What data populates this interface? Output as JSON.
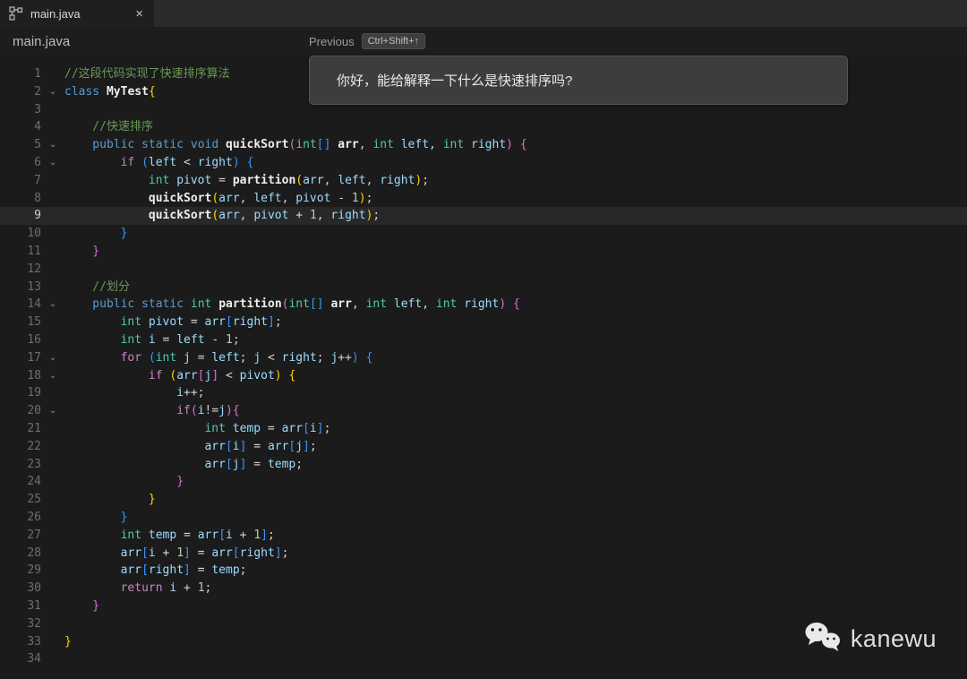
{
  "tab": {
    "title": "main.java",
    "close": "×"
  },
  "breadcrumb": {
    "file": "main.java",
    "previous_label": "Previous",
    "previous_shortcut": "Ctrl+Shift+↑"
  },
  "tooltip": {
    "text": "你好，能给解释一下什么是快速排序吗?"
  },
  "watermark": {
    "text": "kanewu"
  },
  "colors": {
    "editor_bg": "#1b1b1b",
    "active_line_bg": "#282828",
    "tabbar_bg": "#2b2b2b",
    "tooltip_bg": "#3d3d3d",
    "comment": "#6a9955",
    "keyword": "#569cd6",
    "control_keyword": "#c586c0",
    "type": "#4ec9b0",
    "variable": "#9cdcfe",
    "number": "#b5cea8",
    "bracket_yellow": "#ffd602",
    "bracket_pink": "#d670d6",
    "bracket_blue": "#3794ff"
  },
  "editor": {
    "active_line": 9,
    "fold_lines": [
      2,
      5,
      6,
      14,
      17,
      18,
      20
    ],
    "fold_glyph": "⌄",
    "lines": [
      {
        "n": 1,
        "ind": 0,
        "tokens": [
          [
            "c",
            "//这段代码实现了快速排序算法"
          ]
        ]
      },
      {
        "n": 2,
        "ind": 0,
        "tokens": [
          [
            "k",
            "class"
          ],
          [
            "p",
            " "
          ],
          [
            "w",
            "MyTest"
          ],
          [
            "b1",
            "{"
          ]
        ]
      },
      {
        "n": 3,
        "ind": 1,
        "tokens": []
      },
      {
        "n": 4,
        "ind": 1,
        "tokens": [
          [
            "c",
            "//快速排序"
          ]
        ]
      },
      {
        "n": 5,
        "ind": 1,
        "tokens": [
          [
            "k",
            "public"
          ],
          [
            "p",
            " "
          ],
          [
            "k",
            "static"
          ],
          [
            "p",
            " "
          ],
          [
            "k",
            "void"
          ],
          [
            "p",
            " "
          ],
          [
            "m",
            "quickSort"
          ],
          [
            "b2",
            "("
          ],
          [
            "t",
            "int"
          ],
          [
            "b3",
            "[]"
          ],
          [
            "p",
            " "
          ],
          [
            "w",
            "arr"
          ],
          [
            "p",
            ", "
          ],
          [
            "t",
            "int"
          ],
          [
            "p",
            " "
          ],
          [
            "v",
            "left"
          ],
          [
            "p",
            ", "
          ],
          [
            "t",
            "int"
          ],
          [
            "p",
            " "
          ],
          [
            "v",
            "right"
          ],
          [
            "b2",
            ")"
          ],
          [
            "p",
            " "
          ],
          [
            "b2",
            "{"
          ]
        ]
      },
      {
        "n": 6,
        "ind": 2,
        "tokens": [
          [
            "ck",
            "if"
          ],
          [
            "p",
            " "
          ],
          [
            "b3",
            "("
          ],
          [
            "v",
            "left"
          ],
          [
            "p",
            " < "
          ],
          [
            "v",
            "right"
          ],
          [
            "b3",
            ")"
          ],
          [
            "p",
            " "
          ],
          [
            "b3",
            "{"
          ]
        ]
      },
      {
        "n": 7,
        "ind": 3,
        "tokens": [
          [
            "t",
            "int"
          ],
          [
            "p",
            " "
          ],
          [
            "v",
            "pivot"
          ],
          [
            "p",
            " = "
          ],
          [
            "m",
            "partition"
          ],
          [
            "b1",
            "("
          ],
          [
            "v",
            "arr"
          ],
          [
            "p",
            ", "
          ],
          [
            "v",
            "left"
          ],
          [
            "p",
            ", "
          ],
          [
            "v",
            "right"
          ],
          [
            "b1",
            ")"
          ],
          [
            "p",
            ";"
          ]
        ]
      },
      {
        "n": 8,
        "ind": 3,
        "tokens": [
          [
            "m",
            "quickSort"
          ],
          [
            "b1",
            "("
          ],
          [
            "v",
            "arr"
          ],
          [
            "p",
            ", "
          ],
          [
            "v",
            "left"
          ],
          [
            "p",
            ", "
          ],
          [
            "v",
            "pivot"
          ],
          [
            "p",
            " - "
          ],
          [
            "n",
            "1"
          ],
          [
            "b1",
            ")"
          ],
          [
            "p",
            ";"
          ]
        ]
      },
      {
        "n": 9,
        "ind": 3,
        "tokens": [
          [
            "m",
            "quickSort"
          ],
          [
            "b1",
            "("
          ],
          [
            "v",
            "arr"
          ],
          [
            "p",
            ", "
          ],
          [
            "v",
            "pivot"
          ],
          [
            "p",
            " + "
          ],
          [
            "n",
            "1"
          ],
          [
            "p",
            ", "
          ],
          [
            "v",
            "right"
          ],
          [
            "b1",
            ")"
          ],
          [
            "p",
            ";"
          ]
        ]
      },
      {
        "n": 10,
        "ind": 2,
        "tokens": [
          [
            "b3",
            "}"
          ]
        ]
      },
      {
        "n": 11,
        "ind": 1,
        "tokens": [
          [
            "b2",
            "}"
          ]
        ]
      },
      {
        "n": 12,
        "ind": 1,
        "tokens": []
      },
      {
        "n": 13,
        "ind": 1,
        "tokens": [
          [
            "c",
            "//划分"
          ]
        ]
      },
      {
        "n": 14,
        "ind": 1,
        "tokens": [
          [
            "k",
            "public"
          ],
          [
            "p",
            " "
          ],
          [
            "k",
            "static"
          ],
          [
            "p",
            " "
          ],
          [
            "t",
            "int"
          ],
          [
            "p",
            " "
          ],
          [
            "m",
            "partition"
          ],
          [
            "b2",
            "("
          ],
          [
            "t",
            "int"
          ],
          [
            "b3",
            "[]"
          ],
          [
            "p",
            " "
          ],
          [
            "w",
            "arr"
          ],
          [
            "p",
            ", "
          ],
          [
            "t",
            "int"
          ],
          [
            "p",
            " "
          ],
          [
            "v",
            "left"
          ],
          [
            "p",
            ", "
          ],
          [
            "t",
            "int"
          ],
          [
            "p",
            " "
          ],
          [
            "v",
            "right"
          ],
          [
            "b2",
            ")"
          ],
          [
            "p",
            " "
          ],
          [
            "b2",
            "{"
          ]
        ]
      },
      {
        "n": 15,
        "ind": 2,
        "tokens": [
          [
            "t",
            "int"
          ],
          [
            "p",
            " "
          ],
          [
            "v",
            "pivot"
          ],
          [
            "p",
            " = "
          ],
          [
            "v",
            "arr"
          ],
          [
            "b3",
            "["
          ],
          [
            "v",
            "right"
          ],
          [
            "b3",
            "]"
          ],
          [
            "p",
            ";"
          ]
        ]
      },
      {
        "n": 16,
        "ind": 2,
        "tokens": [
          [
            "t",
            "int"
          ],
          [
            "p",
            " "
          ],
          [
            "v",
            "i"
          ],
          [
            "p",
            " = "
          ],
          [
            "v",
            "left"
          ],
          [
            "p",
            " - "
          ],
          [
            "n",
            "1"
          ],
          [
            "p",
            ";"
          ]
        ]
      },
      {
        "n": 17,
        "ind": 2,
        "tokens": [
          [
            "ck",
            "for"
          ],
          [
            "p",
            " "
          ],
          [
            "b3",
            "("
          ],
          [
            "t",
            "int"
          ],
          [
            "p",
            " "
          ],
          [
            "v",
            "j"
          ],
          [
            "p",
            " = "
          ],
          [
            "v",
            "left"
          ],
          [
            "p",
            "; "
          ],
          [
            "v",
            "j"
          ],
          [
            "p",
            " < "
          ],
          [
            "v",
            "right"
          ],
          [
            "p",
            "; "
          ],
          [
            "v",
            "j"
          ],
          [
            "p",
            "++"
          ],
          [
            "b3",
            ")"
          ],
          [
            "p",
            " "
          ],
          [
            "b3",
            "{"
          ]
        ]
      },
      {
        "n": 18,
        "ind": 3,
        "tokens": [
          [
            "ck",
            "if"
          ],
          [
            "p",
            " "
          ],
          [
            "b1",
            "("
          ],
          [
            "v",
            "arr"
          ],
          [
            "b2",
            "["
          ],
          [
            "v",
            "j"
          ],
          [
            "b2",
            "]"
          ],
          [
            "p",
            " < "
          ],
          [
            "v",
            "pivot"
          ],
          [
            "b1",
            ")"
          ],
          [
            "p",
            " "
          ],
          [
            "b1",
            "{"
          ]
        ]
      },
      {
        "n": 19,
        "ind": 4,
        "tokens": [
          [
            "v",
            "i"
          ],
          [
            "p",
            "++;"
          ]
        ]
      },
      {
        "n": 20,
        "ind": 4,
        "tokens": [
          [
            "ck",
            "if"
          ],
          [
            "b2",
            "("
          ],
          [
            "v",
            "i"
          ],
          [
            "p",
            "!="
          ],
          [
            "v",
            "j"
          ],
          [
            "b2",
            ")"
          ],
          [
            "b2",
            "{"
          ]
        ]
      },
      {
        "n": 21,
        "ind": 5,
        "tokens": [
          [
            "t",
            "int"
          ],
          [
            "p",
            " "
          ],
          [
            "v",
            "temp"
          ],
          [
            "p",
            " = "
          ],
          [
            "v",
            "arr"
          ],
          [
            "b3",
            "["
          ],
          [
            "v",
            "i"
          ],
          [
            "b3",
            "]"
          ],
          [
            "p",
            ";"
          ]
        ]
      },
      {
        "n": 22,
        "ind": 5,
        "tokens": [
          [
            "v",
            "arr"
          ],
          [
            "b3",
            "["
          ],
          [
            "v",
            "i"
          ],
          [
            "b3",
            "]"
          ],
          [
            "p",
            " = "
          ],
          [
            "v",
            "arr"
          ],
          [
            "b3",
            "["
          ],
          [
            "v",
            "j"
          ],
          [
            "b3",
            "]"
          ],
          [
            "p",
            ";"
          ]
        ]
      },
      {
        "n": 23,
        "ind": 5,
        "tokens": [
          [
            "v",
            "arr"
          ],
          [
            "b3",
            "["
          ],
          [
            "v",
            "j"
          ],
          [
            "b3",
            "]"
          ],
          [
            "p",
            " = "
          ],
          [
            "v",
            "temp"
          ],
          [
            "p",
            ";"
          ]
        ]
      },
      {
        "n": 24,
        "ind": 4,
        "tokens": [
          [
            "b2",
            "}"
          ]
        ]
      },
      {
        "n": 25,
        "ind": 3,
        "tokens": [
          [
            "b1",
            "}"
          ]
        ]
      },
      {
        "n": 26,
        "ind": 2,
        "tokens": [
          [
            "b3",
            "}"
          ]
        ]
      },
      {
        "n": 27,
        "ind": 2,
        "tokens": [
          [
            "t",
            "int"
          ],
          [
            "p",
            " "
          ],
          [
            "v",
            "temp"
          ],
          [
            "p",
            " = "
          ],
          [
            "v",
            "arr"
          ],
          [
            "b3",
            "["
          ],
          [
            "v",
            "i"
          ],
          [
            "p",
            " + "
          ],
          [
            "n",
            "1"
          ],
          [
            "b3",
            "]"
          ],
          [
            "p",
            ";"
          ]
        ]
      },
      {
        "n": 28,
        "ind": 2,
        "tokens": [
          [
            "v",
            "arr"
          ],
          [
            "b3",
            "["
          ],
          [
            "v",
            "i"
          ],
          [
            "p",
            " + "
          ],
          [
            "n",
            "1"
          ],
          [
            "b3",
            "]"
          ],
          [
            "p",
            " = "
          ],
          [
            "v",
            "arr"
          ],
          [
            "b3",
            "["
          ],
          [
            "v",
            "right"
          ],
          [
            "b3",
            "]"
          ],
          [
            "p",
            ";"
          ]
        ]
      },
      {
        "n": 29,
        "ind": 2,
        "tokens": [
          [
            "v",
            "arr"
          ],
          [
            "b3",
            "["
          ],
          [
            "v",
            "right"
          ],
          [
            "b3",
            "]"
          ],
          [
            "p",
            " = "
          ],
          [
            "v",
            "temp"
          ],
          [
            "p",
            ";"
          ]
        ]
      },
      {
        "n": 30,
        "ind": 2,
        "tokens": [
          [
            "ck",
            "return"
          ],
          [
            "p",
            " "
          ],
          [
            "v",
            "i"
          ],
          [
            "p",
            " + "
          ],
          [
            "n",
            "1"
          ],
          [
            "p",
            ";"
          ]
        ]
      },
      {
        "n": 31,
        "ind": 1,
        "tokens": [
          [
            "b2",
            "}"
          ]
        ]
      },
      {
        "n": 32,
        "ind": 1,
        "tokens": []
      },
      {
        "n": 33,
        "ind": 0,
        "tokens": [
          [
            "b1",
            "}"
          ]
        ]
      },
      {
        "n": 34,
        "ind": 0,
        "tokens": []
      }
    ]
  }
}
